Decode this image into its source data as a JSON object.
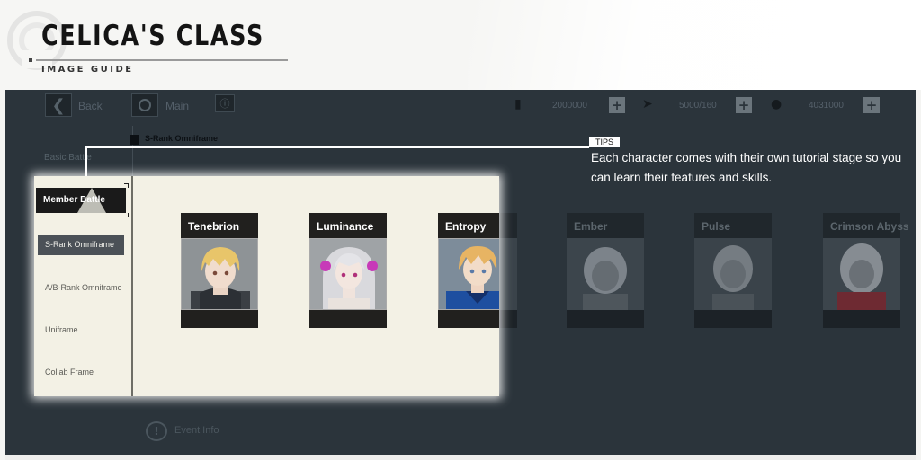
{
  "header": {
    "title": "CELICA'S CLASS",
    "subtitle": "IMAGE GUIDE"
  },
  "topbar": {
    "back_label": "Back",
    "main_label": "Main",
    "resources": [
      {
        "icon": "ticket-icon",
        "value": "2000000"
      },
      {
        "icon": "wing-icon",
        "value": "5000/160"
      },
      {
        "icon": "coin-icon",
        "value": "4031000"
      }
    ]
  },
  "side_menu": {
    "basic_battle": "Basic Battle",
    "member_battle": "Member Battle",
    "items": [
      {
        "label": "S-Rank Omniframe",
        "selected": true
      },
      {
        "label": "A/B-Rank Omniframe",
        "selected": false
      },
      {
        "label": "Uniframe",
        "selected": false
      },
      {
        "label": "Collab Frame",
        "selected": false
      }
    ]
  },
  "section_title": "S-Rank Omniframe",
  "characters": [
    {
      "name": "Tenebrion",
      "hair": "#e8c56a",
      "outfit": "#3b3f44",
      "highlighted": true
    },
    {
      "name": "Luminance",
      "hair": "#d9d9dd",
      "outfit": "#e9e2dd",
      "highlighted": true
    },
    {
      "name": "Entropy",
      "hair": "#e7b463",
      "outfit": "#1e4fa0",
      "highlighted": true
    },
    {
      "name": "Ember",
      "hair": "#8a9096",
      "outfit": "#4e565c",
      "highlighted": false
    },
    {
      "name": "Pulse",
      "hair": "#7f868c",
      "outfit": "#4a5258",
      "highlighted": false
    },
    {
      "name": "Crimson Abyss",
      "hair": "#8c9298",
      "outfit": "#6e2a32",
      "highlighted": false
    }
  ],
  "event_info_label": "Event Info",
  "tips": {
    "badge": "TIPS",
    "text": "Each character comes with their own tutorial stage so you can learn their features and skills."
  },
  "colors": {
    "game_bg": "#2b343b",
    "highlight_panel": "#f3f1e5",
    "menu_selected": "#4b5157"
  }
}
